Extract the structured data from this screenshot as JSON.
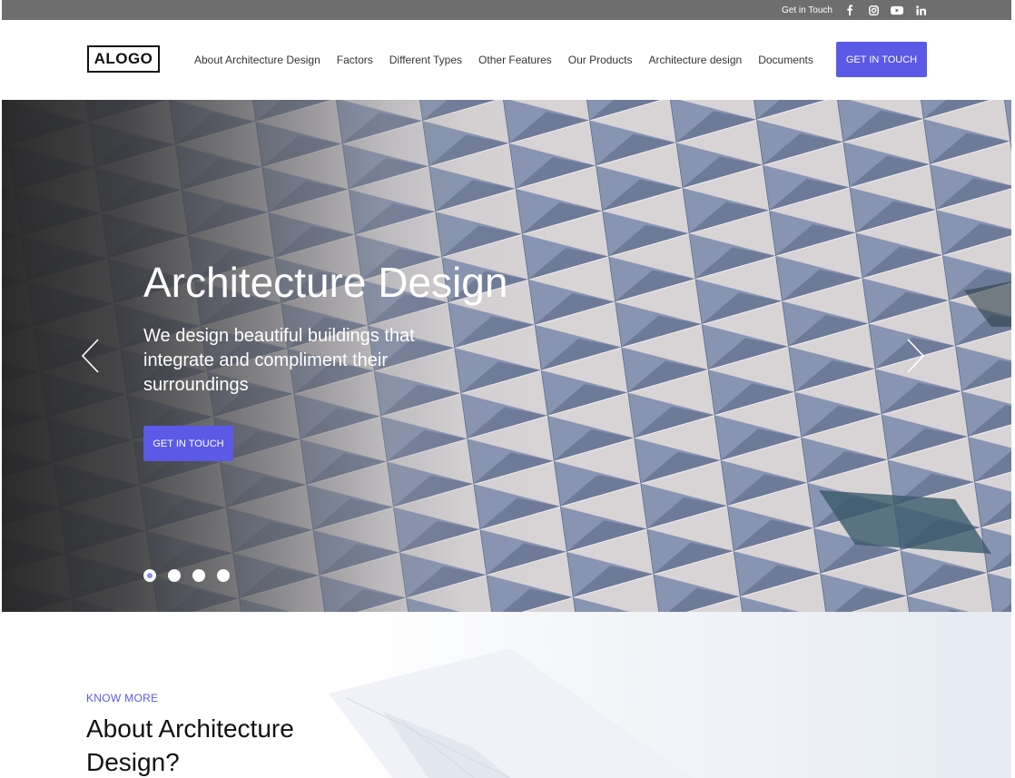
{
  "topbar": {
    "contact_label": "Get in Touch",
    "social": [
      {
        "name": "facebook-icon"
      },
      {
        "name": "instagram-icon"
      },
      {
        "name": "youtube-icon"
      },
      {
        "name": "linkedin-icon"
      }
    ]
  },
  "header": {
    "logo": "ALOGO",
    "nav": [
      "About Architecture Design",
      "Factors",
      "Different Types",
      "Other Features",
      "Our Products",
      "Architecture design",
      "Documents"
    ],
    "cta_label": "GET IN TOUCH"
  },
  "hero": {
    "title": "Architecture Design",
    "subtitle": "We design beautiful buildings that integrate and compliment their surroundings",
    "cta_label": "GET IN TOUCH",
    "slides_total": 4,
    "active_slide": 1
  },
  "about": {
    "eyebrow": "KNOW MORE",
    "title": "About Architecture Design?"
  },
  "colors": {
    "accent": "#5a5ae6",
    "topbar_bg": "#6e6e6e",
    "dot_active": "#8a8ae8"
  }
}
